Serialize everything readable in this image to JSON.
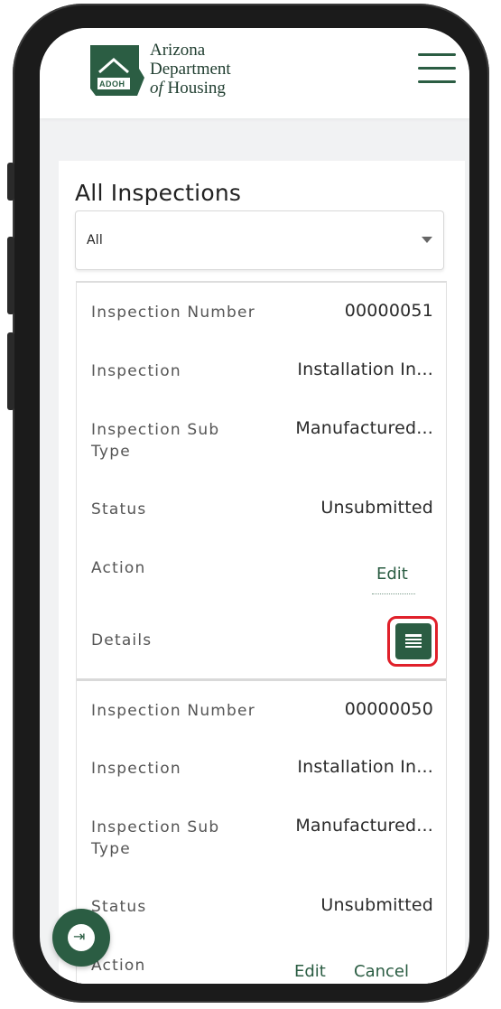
{
  "header": {
    "logo_line1": "Arizona",
    "logo_line2": "Department",
    "logo_line3_prefix": "of",
    "logo_line3_rest": " Housing",
    "logo_badge": "ADOH",
    "menu_icon": "hamburger-menu-icon"
  },
  "page": {
    "title": "All Inspections"
  },
  "filter": {
    "selected": "All"
  },
  "records": [
    {
      "number_label": "Inspection Number",
      "number": "00000051",
      "inspection_label": "Inspection",
      "inspection": "Installation In...",
      "subtype_label": "Inspection Sub Type",
      "subtype": "Manufactured...",
      "status_label": "Status",
      "status": "Unsubmitted",
      "action_label": "Action",
      "edit": "Edit",
      "details_label": "Details",
      "details_icon": "list-details-icon"
    },
    {
      "number_label": "Inspection Number",
      "number": "00000050",
      "inspection_label": "Inspection",
      "inspection": "Installation In...",
      "subtype_label": "Inspection Sub Type",
      "subtype": "Manufactured...",
      "status_label": "Status",
      "status": "Unsubmitted",
      "action_label": "Action",
      "edit": "Edit",
      "cancel": "Cancel"
    }
  ],
  "fab": {
    "icon": "collapse-arrow-icon",
    "glyph": "⇥"
  },
  "colors": {
    "accent": "#2b5d43",
    "highlight": "#e0202a"
  }
}
